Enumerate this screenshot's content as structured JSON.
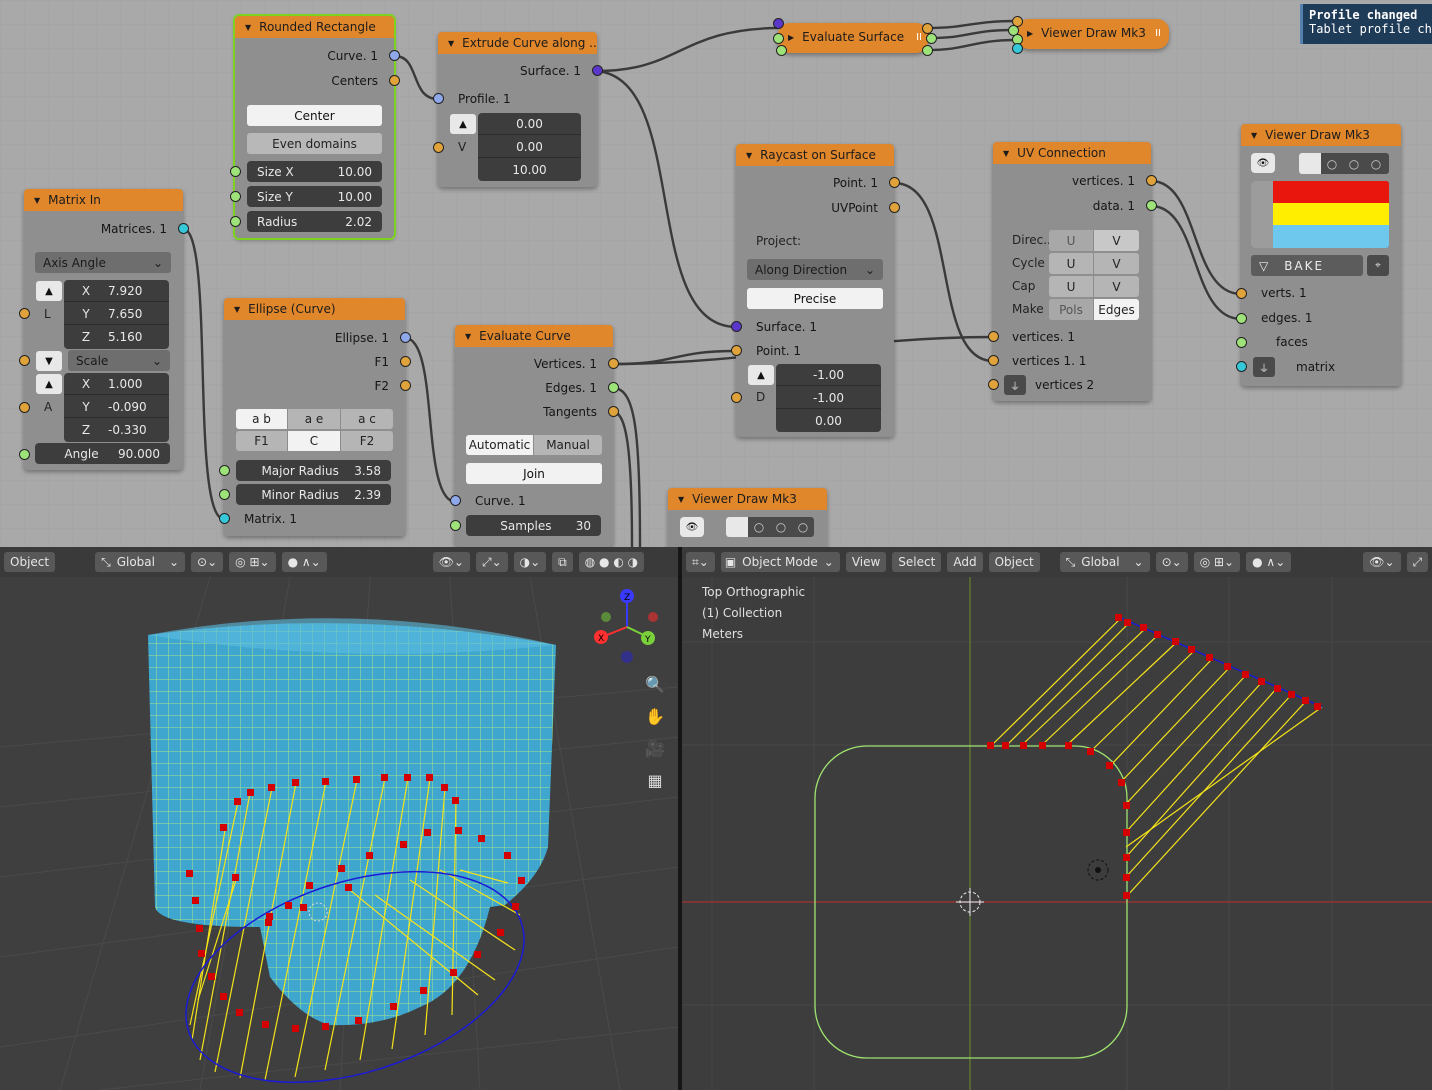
{
  "notification": {
    "title": "Profile changed",
    "body": "Tablet profile changed"
  },
  "nodes": {
    "rounded_rect": {
      "title": "Rounded Rectangle",
      "out_curve": "Curve. 1",
      "out_centers": "Centers",
      "center_btn": "Center",
      "even_btn": "Even domains",
      "size_x_label": "Size X",
      "size_x": "10.00",
      "size_y_label": "Size Y",
      "size_y": "10.00",
      "radius_label": "Radius",
      "radius": "2.02"
    },
    "extrude": {
      "title": "Extrude Curve along ..",
      "out_surface": "Surface. 1",
      "in_profile": "Profile. 1",
      "v_label": "V",
      "v": [
        "0.00",
        "0.00",
        "10.00"
      ]
    },
    "eval_surface": {
      "title": "Evaluate Surface"
    },
    "viewer_top": {
      "title": "Viewer Draw Mk3"
    },
    "matrix_in": {
      "title": "Matrix In",
      "out": "Matrices. 1",
      "mode": "Axis Angle",
      "l_label": "L",
      "lx_l": "X",
      "lx": "7.920",
      "ly_l": "Y",
      "ly": "7.650",
      "lz_l": "Z",
      "lz": "5.160",
      "scale": "Scale",
      "a_label": "A",
      "ax_l": "X",
      "ax": "1.000",
      "ay_l": "Y",
      "ay": "-0.090",
      "az_l": "Z",
      "az": "-0.330",
      "angle_label": "Angle",
      "angle": "90.000"
    },
    "ellipse": {
      "title": "Ellipse (Curve)",
      "out_ellipse": "Ellipse. 1",
      "out_f1": "F1",
      "out_f2": "F2",
      "seg1": [
        "a b",
        "a e",
        "a c"
      ],
      "seg2": [
        "F1",
        "C",
        "F2"
      ],
      "major_label": "Major Radius",
      "major": "3.58",
      "minor_label": "Minor Radius",
      "minor": "2.39",
      "in_matrix": "Matrix. 1"
    },
    "eval_curve": {
      "title": "Evaluate Curve",
      "out_vertices": "Vertices. 1",
      "out_edges": "Edges. 1",
      "out_tangents": "Tangents",
      "auto": "Automatic",
      "manual": "Manual",
      "join": "Join",
      "in_curve": "Curve. 1",
      "samples_label": "Samples",
      "samples": "30"
    },
    "viewer_bottom": {
      "title": "Viewer Draw Mk3"
    },
    "raycast": {
      "title": "Raycast on Surface",
      "out_point": "Point. 1",
      "out_uvpoint": "UVPoint",
      "project_label": "Project:",
      "project": "Along Direction",
      "precise": "Precise",
      "in_surface": "Surface. 1",
      "in_point": "Point. 1",
      "d_label": "D",
      "d": [
        "-1.00",
        "-1.00",
        "0.00"
      ]
    },
    "uv_conn": {
      "title": "UV Connection",
      "out_vertices": "vertices. 1",
      "out_data": "data. 1",
      "direc": "Direc..",
      "cycle": "Cycle",
      "cap": "Cap",
      "make": "Make",
      "u": "U",
      "v": "V",
      "pols": "Pols",
      "edges": "Edges",
      "in_v1": "vertices. 1",
      "in_v11": "vertices 1. 1",
      "in_v2": "vertices 2"
    },
    "viewer_right": {
      "title": "Viewer Draw Mk3",
      "bake": "BAKE",
      "in_verts": "verts. 1",
      "in_edges": "edges. 1",
      "in_faces": "faces",
      "in_matrix": "matrix",
      "colors": [
        "#e8160c",
        "#ffee00",
        "#6ec8ee"
      ]
    }
  },
  "viewport_left": {
    "header": {
      "mode": "Object",
      "orientation": "Global"
    },
    "gizmo": {
      "x": "X",
      "y": "Y",
      "z": "Z"
    }
  },
  "viewport_right": {
    "header": {
      "mode": "Object Mode",
      "view": "View",
      "select": "Select",
      "add": "Add",
      "object": "Object",
      "orientation": "Global"
    },
    "overlay": {
      "view_name": "Top Orthographic",
      "collection": "(1) Collection",
      "units": "Meters"
    }
  }
}
